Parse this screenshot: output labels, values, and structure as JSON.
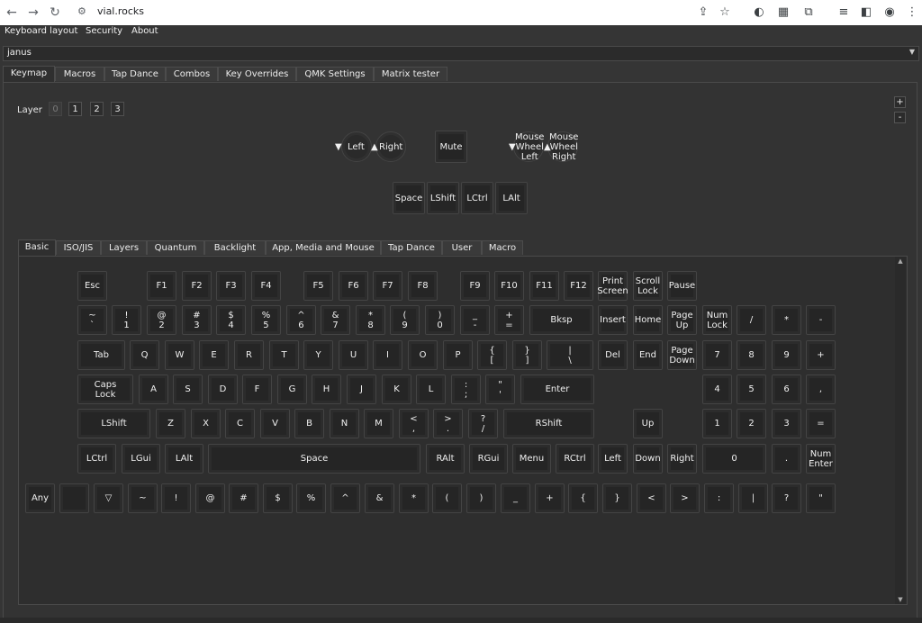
{
  "browser": {
    "url": "vial.rocks",
    "back_icon": "arrow-left-icon",
    "forward_icon": "arrow-right-icon",
    "reload_icon": "reload-icon"
  },
  "menu": [
    "Keyboard layout",
    "Security",
    "About"
  ],
  "keyboard_select": {
    "value": "janus"
  },
  "main_tabs": [
    "Keymap",
    "Macros",
    "Tap Dance",
    "Combos",
    "Key Overrides",
    "QMK Settings",
    "Matrix tester"
  ],
  "layer": {
    "label": "Layer",
    "options": [
      "0",
      "1",
      "2",
      "3"
    ],
    "active": "0"
  },
  "zoom": {
    "plus": "+",
    "minus": "-"
  },
  "encoders": {
    "left_ccw": "Left",
    "left_cw": "Right",
    "right_ccw": "Mouse\nWheel\nLeft",
    "right_cw": "Mouse\nWheel\nRight",
    "ccw_arrow": "❮",
    "cw_arrow": "❯"
  },
  "top_keys": {
    "mute": "Mute",
    "thumb": [
      "Space",
      "LShift",
      "LCtrl",
      "LAlt"
    ]
  },
  "keycode_tabs": [
    "Basic",
    "ISO/JIS",
    "Layers",
    "Quantum",
    "Backlight",
    "App, Media and Mouse",
    "Tap Dance",
    "User",
    "Macro"
  ],
  "rows": {
    "r1": [
      "Esc",
      "F1",
      "F2",
      "F3",
      "F4",
      "F5",
      "F6",
      "F7",
      "F8",
      "F9",
      "F10",
      "F11",
      "F12",
      "Print\nScreen",
      "Scroll\nLock",
      "Pause"
    ],
    "r2": [
      "~\n`",
      "!\n1",
      "@\n2",
      "#\n3",
      "$\n4",
      "%\n5",
      "^\n6",
      "&\n7",
      "*\n8",
      "(\n9",
      ")\n0",
      "_\n-",
      "+\n=",
      "Bksp",
      "Insert",
      "Home",
      "Page\nUp",
      "Num\nLock",
      "/",
      "*",
      "-"
    ],
    "r3": [
      "Tab",
      "Q",
      "W",
      "E",
      "R",
      "T",
      "Y",
      "U",
      "I",
      "O",
      "P",
      "{\n[",
      "}\n]",
      "|\n\\",
      "Del",
      "End",
      "Page\nDown",
      "7",
      "8",
      "9",
      "+"
    ],
    "r4": [
      "Caps\nLock",
      "A",
      "S",
      "D",
      "F",
      "G",
      "H",
      "J",
      "K",
      "L",
      ":\n;",
      "\"\n'",
      "Enter",
      "4",
      "5",
      "6",
      ","
    ],
    "r5": [
      "LShift",
      "Z",
      "X",
      "C",
      "V",
      "B",
      "N",
      "M",
      "<\n,",
      ">\n.",
      "?\n/",
      "RShift",
      "Up",
      "1",
      "2",
      "3",
      "="
    ],
    "r6": [
      "LCtrl",
      "LGui",
      "LAlt",
      "Space",
      "RAlt",
      "RGui",
      "Menu",
      "RCtrl",
      "Left",
      "Down",
      "Right",
      "0",
      ".",
      "Num\nEnter"
    ],
    "r7": [
      "Any",
      "",
      "▽",
      "~",
      "!",
      "@",
      "#",
      "$",
      "%",
      "^",
      "&",
      "*",
      "(",
      ")",
      "_",
      "+",
      "{",
      "}",
      "<",
      ">",
      ":",
      "|",
      "?",
      "\""
    ]
  }
}
